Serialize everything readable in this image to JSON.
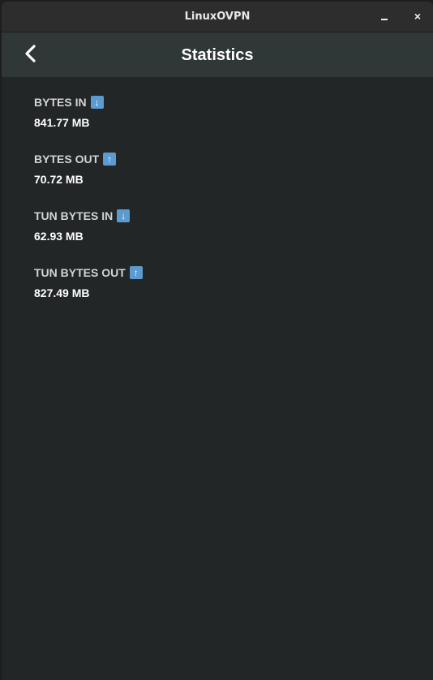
{
  "window": {
    "title": "LinuxOVPN",
    "close": "×"
  },
  "header": {
    "title": "Statistics"
  },
  "stats": [
    {
      "label": "BYTES IN",
      "icon": "arrow-down",
      "glyph": "↓",
      "value": "841.77 MB"
    },
    {
      "label": "BYTES OUT",
      "icon": "arrow-up",
      "glyph": "↑",
      "value": "70.72 MB"
    },
    {
      "label": "TUN BYTES IN",
      "icon": "arrow-down",
      "glyph": "↓",
      "value": "62.93 MB"
    },
    {
      "label": "TUN BYTES OUT",
      "icon": "arrow-up",
      "glyph": "↑",
      "value": "827.49 MB"
    }
  ]
}
